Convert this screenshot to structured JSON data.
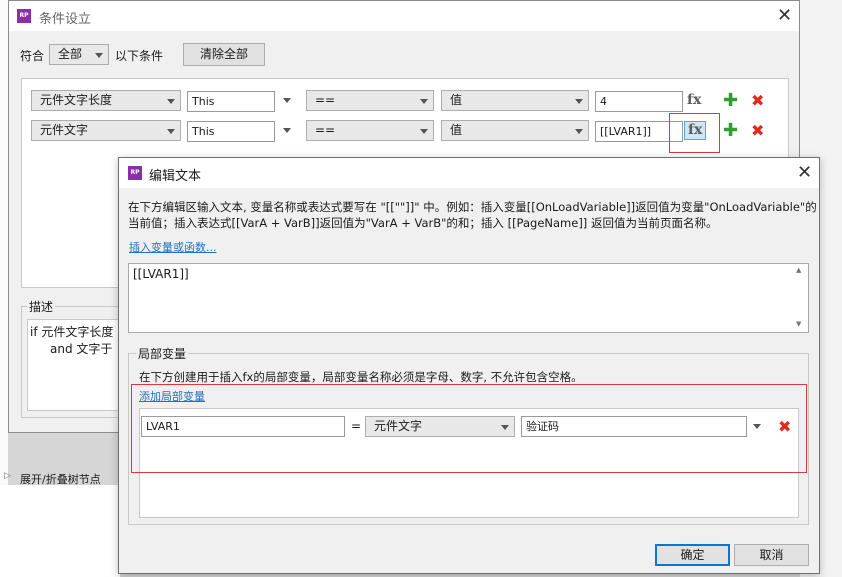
{
  "background_window": {
    "title": "条件设立",
    "match_prefix": "符合",
    "match_select": "全部",
    "match_suffix": "以下条件",
    "clear_all_button": "清除全部",
    "rows": [
      {
        "field": "元件文字长度",
        "target": "This",
        "operator": "==",
        "value_type": "值",
        "value": "4"
      },
      {
        "field": "元件文字",
        "target": "This",
        "operator": "==",
        "value_type": "值",
        "value": "[[LVAR1]]"
      }
    ],
    "fx_label": "fx",
    "description_title": "描述",
    "description_line1": "if 元件文字长度 ",
    "description_line2": "and 文字于 ",
    "tree_toggle": "展开/折叠树节点"
  },
  "edit_dialog": {
    "title": "编辑文本",
    "help_line1": "在下方编辑区输入文本, 变量名称或表达式要写在 \"[[\"\"]]\" 中。例如：插入变量[[OnLoadVariable]]返回值为变量\"OnLoadVariable\"的",
    "help_line2": "当前值；插入表达式[[VarA + VarB]]返回值为\"VarA + VarB\"的和；插入 [[PageName]] 返回值为当前页面名称。",
    "insert_link": "插入变量或函数...",
    "editor_text": "[[LVAR1]]",
    "local_vars_title": "局部变量",
    "local_vars_help": "在下方创建用于插入fx的局部变量，局部变量名称必须是字母、数字, 不允许包含空格。",
    "add_local_link": "添加局部变量",
    "local_var": {
      "name": "LVAR1",
      "equals": "=",
      "type": "元件文字",
      "target": "验证码"
    },
    "ok_button": "确定",
    "cancel_button": "取消"
  }
}
